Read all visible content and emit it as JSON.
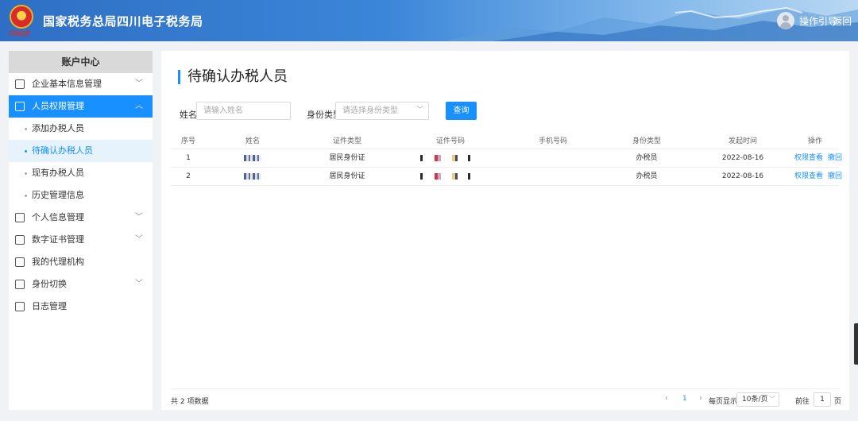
{
  "header": {
    "emblem_text": "中国税务",
    "site_title": "国家税务总局四川电子税务局",
    "guide_label": "操作引导",
    "back_label": "返回"
  },
  "sidebar": {
    "title": "账户中心",
    "items": [
      {
        "label": "企业基本信息管理",
        "icon": "building-icon",
        "has_chevron": true
      },
      {
        "label": "人员权限管理",
        "icon": "user-lock-icon",
        "has_chevron": true,
        "active": true,
        "children": [
          {
            "label": "添加办税人员"
          },
          {
            "label": "待确认办税人员",
            "active": true
          },
          {
            "label": "现有办税人员"
          },
          {
            "label": "历史管理信息"
          }
        ]
      },
      {
        "label": "个人信息管理",
        "icon": "id-card-icon",
        "has_chevron": true
      },
      {
        "label": "数字证书管理",
        "icon": "certificate-icon",
        "has_chevron": true
      },
      {
        "label": "我的代理机构",
        "icon": "agency-icon",
        "has_chevron": false
      },
      {
        "label": "身份切换",
        "icon": "switch-icon",
        "has_chevron": true
      },
      {
        "label": "日志管理",
        "icon": "log-icon",
        "has_chevron": false
      }
    ]
  },
  "main": {
    "title": "待确认办税人员",
    "search": {
      "name_label": "姓名",
      "name_placeholder": "请输入姓名",
      "type_label": "身份类型",
      "type_placeholder": "请选择身份类型",
      "query_label": "查询"
    },
    "table": {
      "headers": [
        "序号",
        "姓名",
        "证件类型",
        "证件号码",
        "手机号码",
        "身份类型",
        "发起时间",
        "操作"
      ],
      "rows": [
        {
          "no": "1",
          "id_type": "居民身份证",
          "role": "办税员",
          "time": "2022-08-16",
          "action1": "权限查看",
          "action2": "撤回"
        },
        {
          "no": "2",
          "id_type": "居民身份证",
          "role": "办税员",
          "time": "2022-08-16",
          "action1": "权限查看",
          "action2": "撤回"
        }
      ]
    },
    "pagination": {
      "total": "共 2 项数据",
      "prev": "‹",
      "page": "1",
      "next": "›",
      "per_page_label": "每页显示",
      "per_page_value": "10条/页",
      "goto_label": "前往",
      "goto_value": "1",
      "goto_unit": "页"
    }
  }
}
